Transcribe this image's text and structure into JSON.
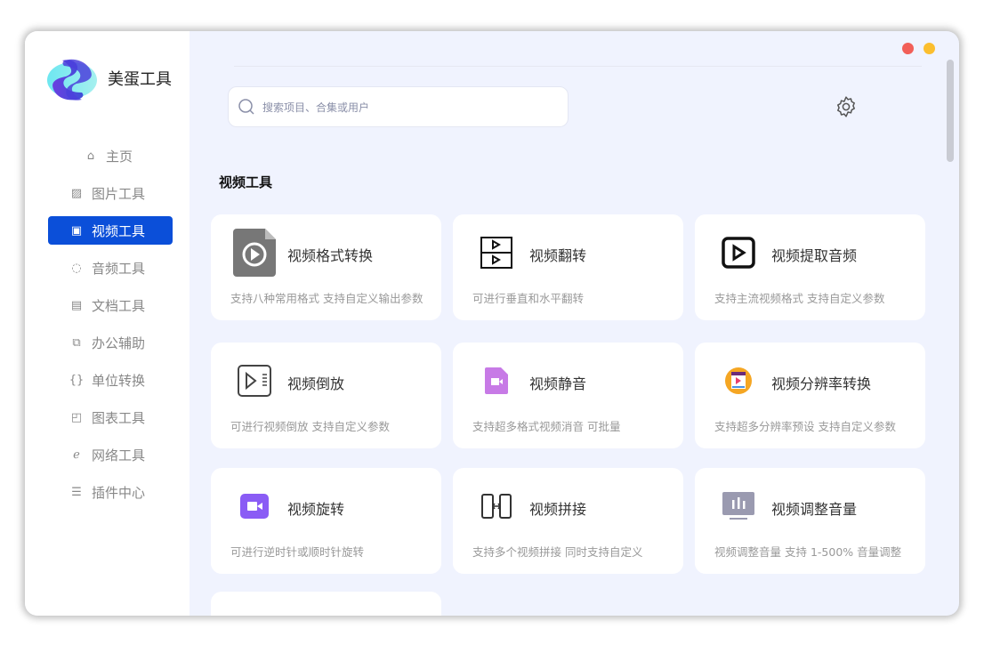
{
  "app": {
    "name": "美蛋工具"
  },
  "sidebar": {
    "items": [
      {
        "label": "主页",
        "icon": "home-icon"
      },
      {
        "label": "图片工具",
        "icon": "image-icon"
      },
      {
        "label": "视频工具",
        "icon": "projector-icon",
        "active": true
      },
      {
        "label": "音频工具",
        "icon": "headset-icon"
      },
      {
        "label": "文档工具",
        "icon": "document-icon"
      },
      {
        "label": "办公辅助",
        "icon": "copy-icon"
      },
      {
        "label": "单位转换",
        "icon": "braces-icon"
      },
      {
        "label": "图表工具",
        "icon": "chart-icon"
      },
      {
        "label": "网络工具",
        "icon": "browser-icon"
      },
      {
        "label": "插件中心",
        "icon": "sliders-icon"
      }
    ]
  },
  "search": {
    "placeholder": "搜索项目、合集或用户"
  },
  "section": {
    "title": "视频工具"
  },
  "colors": {
    "accent": "#0b4fd9",
    "close": "#f25f58",
    "minimize": "#fbbe2e",
    "bg": "#f0f3fe"
  },
  "cards": [
    {
      "title": "视频格式转换",
      "desc": "支持八种常用格式 支持自定义输出参数"
    },
    {
      "title": "视频翻转",
      "desc": "可进行垂直和水平翻转"
    },
    {
      "title": "视频提取音频",
      "desc": "支持主流视频格式 支持自定义参数"
    },
    {
      "title": "视频倒放",
      "desc": "可进行视频倒放 支持自定义参数"
    },
    {
      "title": "视频静音",
      "desc": "支持超多格式视频消音 可批量"
    },
    {
      "title": "视频分辨率转换",
      "desc": "支持超多分辨率预设 支持自定义参数"
    },
    {
      "title": "视频旋转",
      "desc": "可进行逆时针或顺时针旋转"
    },
    {
      "title": "视频拼接",
      "desc": "支持多个视频拼接 同时支持自定义"
    },
    {
      "title": "视频调整音量",
      "desc": "视频调整音量 支持 1-500% 音量调整"
    }
  ]
}
